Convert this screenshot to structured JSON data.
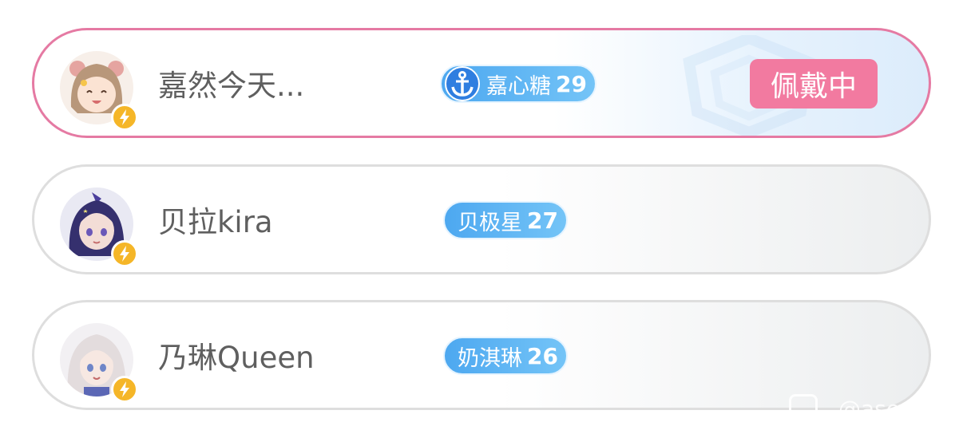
{
  "rows": [
    {
      "name": "嘉然今天...",
      "medal": {
        "name": "嘉心糖",
        "level": "29",
        "icon": "anchor-icon"
      },
      "action_label": "佩戴中",
      "active": true,
      "avatar_hair": "#b8977a",
      "avatar_skin": "#fbe3d3",
      "avatar_bg": "#f7efe9"
    },
    {
      "name": "贝拉kira",
      "medal": {
        "name": "贝极星",
        "level": "27"
      },
      "active": false,
      "avatar_hair": "#35306e",
      "avatar_skin": "#f3ddd6",
      "avatar_bg": "#e9e9f3"
    },
    {
      "name": "乃琳Queen",
      "medal": {
        "name": "奶淇琳",
        "level": "26"
      },
      "active": false,
      "avatar_hair": "#e3dcdd",
      "avatar_skin": "#f7e8e2",
      "avatar_bg": "#f2f0f3"
    }
  ],
  "colors": {
    "active_border": "#e57aa3",
    "wear_button": "#f27aa0",
    "medal": "#4da8f0",
    "bolt_badge": "#f5b628"
  },
  "watermark": {
    "text": "@ase"
  }
}
